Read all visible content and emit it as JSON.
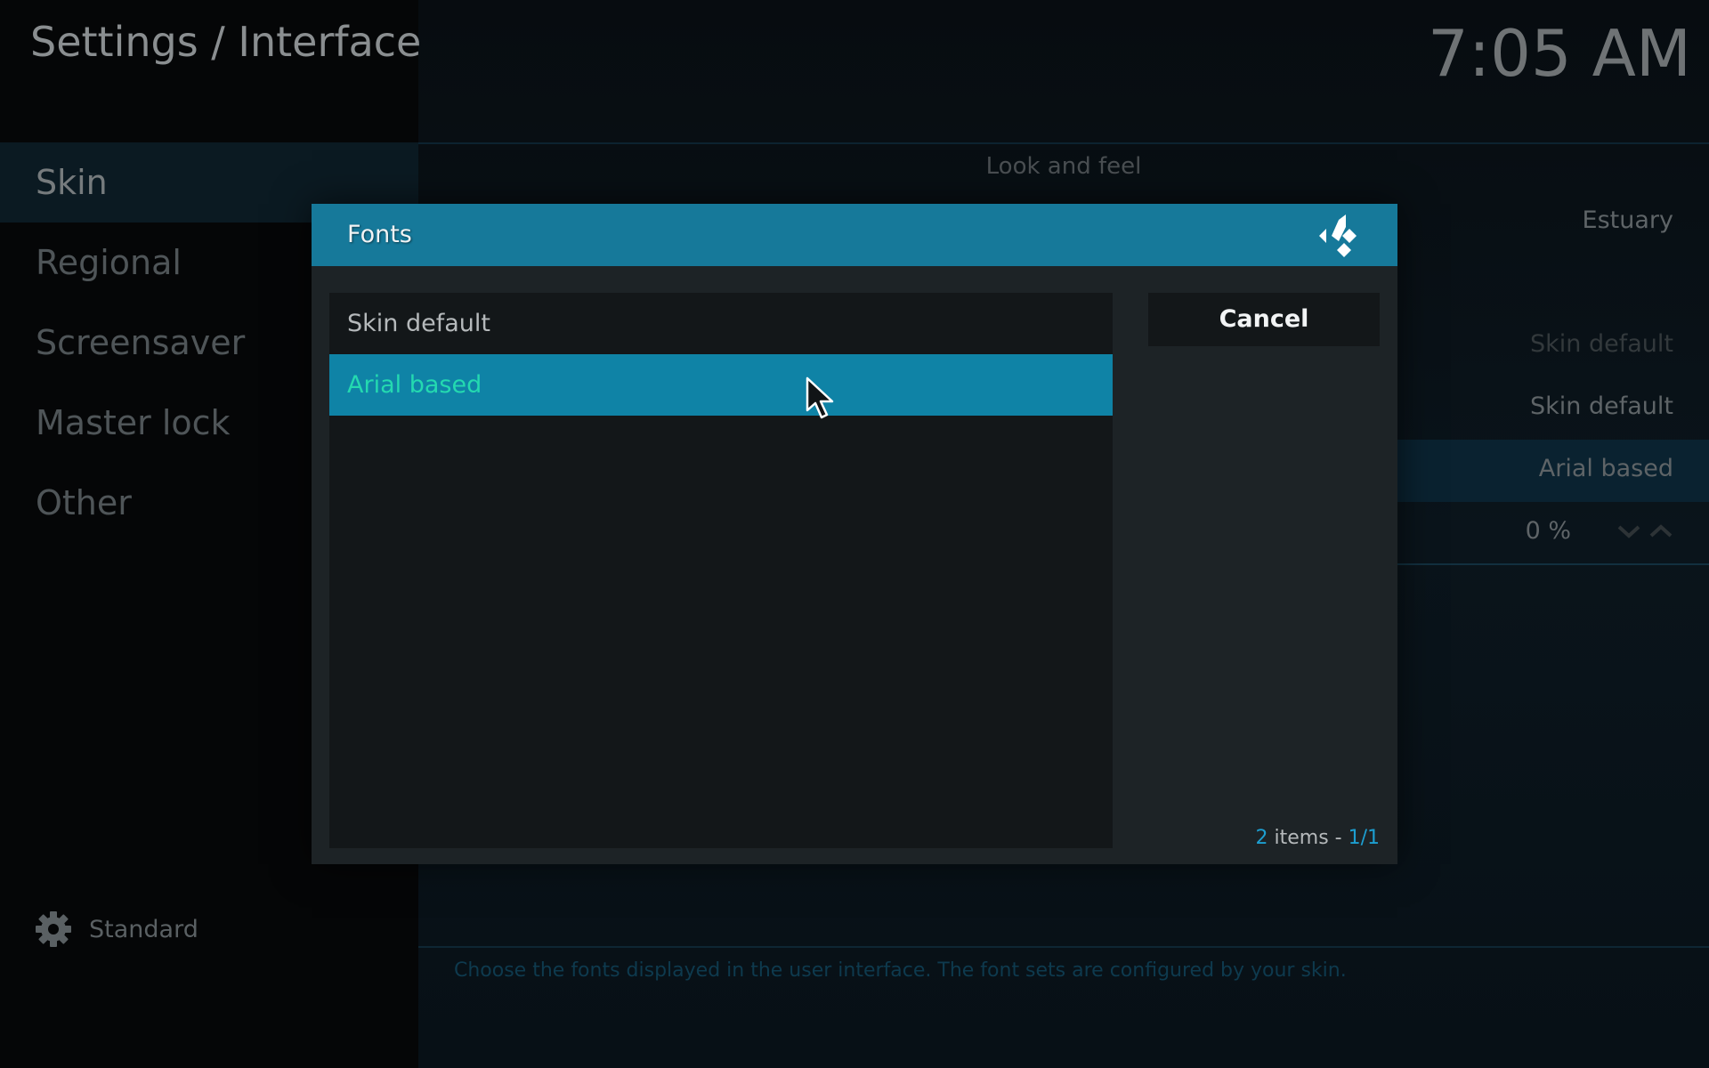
{
  "header": {
    "title": "Settings / Interface",
    "clock": "7:05 AM"
  },
  "sidebar": {
    "items": [
      {
        "label": "Skin"
      },
      {
        "label": "Regional"
      },
      {
        "label": "Screensaver"
      },
      {
        "label": "Master lock"
      },
      {
        "label": "Other"
      }
    ],
    "settings_level": {
      "label": "Standard",
      "icon": "gear-icon"
    }
  },
  "settings_list": {
    "section_label": "Look and feel",
    "values": [
      "Estuary",
      "Skin default",
      "Skin default",
      "Arial based",
      "0 %"
    ],
    "footer_description": "Choose the fonts displayed in the user interface. The font sets are configured by your skin."
  },
  "dialog": {
    "title": "Fonts",
    "logo_icon": "kodi-logo-icon",
    "options": [
      {
        "label": "Skin default",
        "selected": false
      },
      {
        "label": "Arial based",
        "selected": true
      }
    ],
    "cancel_label": "Cancel",
    "count": {
      "total": "2",
      "items_text": " items - ",
      "page": "1/1"
    }
  },
  "colors": {
    "header_blue": "#16799a",
    "selected_row": "#0f83a6",
    "selected_text": "#24d9b0",
    "accent": "#1d9ed0"
  }
}
